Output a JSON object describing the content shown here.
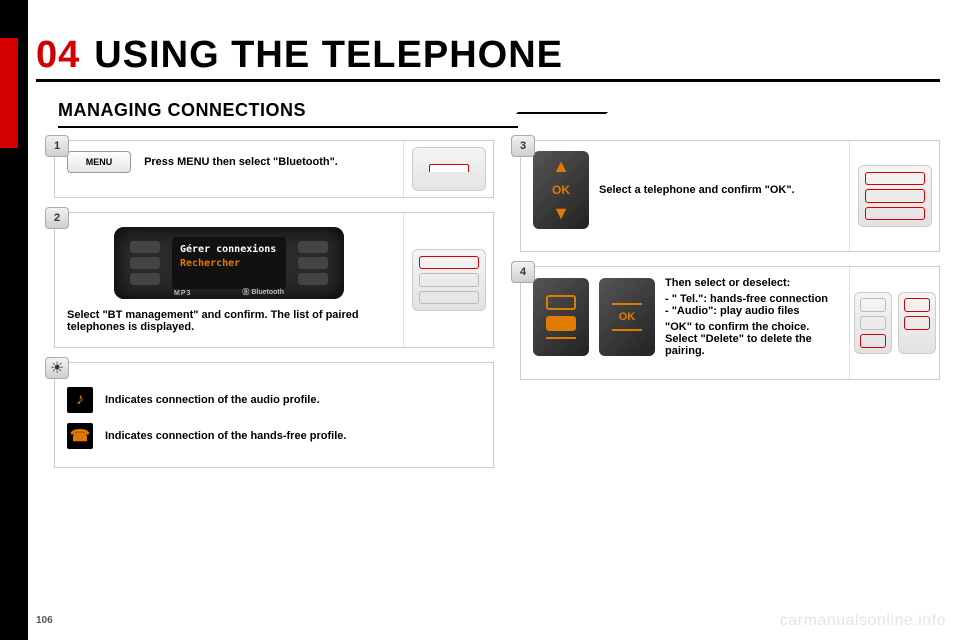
{
  "chapter": "04",
  "title": "USING THE TELEPHONE",
  "subtitle": "MANAGING CONNECTIONS",
  "page_number": "106",
  "watermark": "carmanualsonline.info",
  "menu_button_label": "MENU",
  "steps": {
    "s1": {
      "badge": "1",
      "text": "Press MENU then select \"Bluetooth\"."
    },
    "s2": {
      "badge": "2",
      "screen_line1": "Gérer connexions",
      "screen_line2": "Rechercher",
      "radio_label_mp3": "MP3",
      "radio_label_bt": "Ⓑ Bluetooth",
      "text": "Select \"BT management\" and confirm. The list of paired telephones is displayed."
    },
    "s3": {
      "badge": "3",
      "ok_glyph": "OK",
      "text": "Select a telephone and confirm \"OK\"."
    },
    "s4": {
      "badge": "4",
      "ok_glyph": "OK",
      "intro": "Then select or deselect:",
      "bullet1": "-  \" Tel.\": hands-free connection",
      "bullet2": "-  \"Audio\": play audio files",
      "line3": "\"OK\" to confirm the choice.",
      "line4": "Select \"Delete\" to delete the pairing."
    }
  },
  "notes": {
    "audio": "Indicates connection of the audio profile.",
    "handsfree": "Indicates connection of the hands-free profile."
  },
  "glyphs": {
    "music": "♪",
    "phone": "☎",
    "tip": "☀",
    "up": "▲",
    "down": "▼"
  }
}
